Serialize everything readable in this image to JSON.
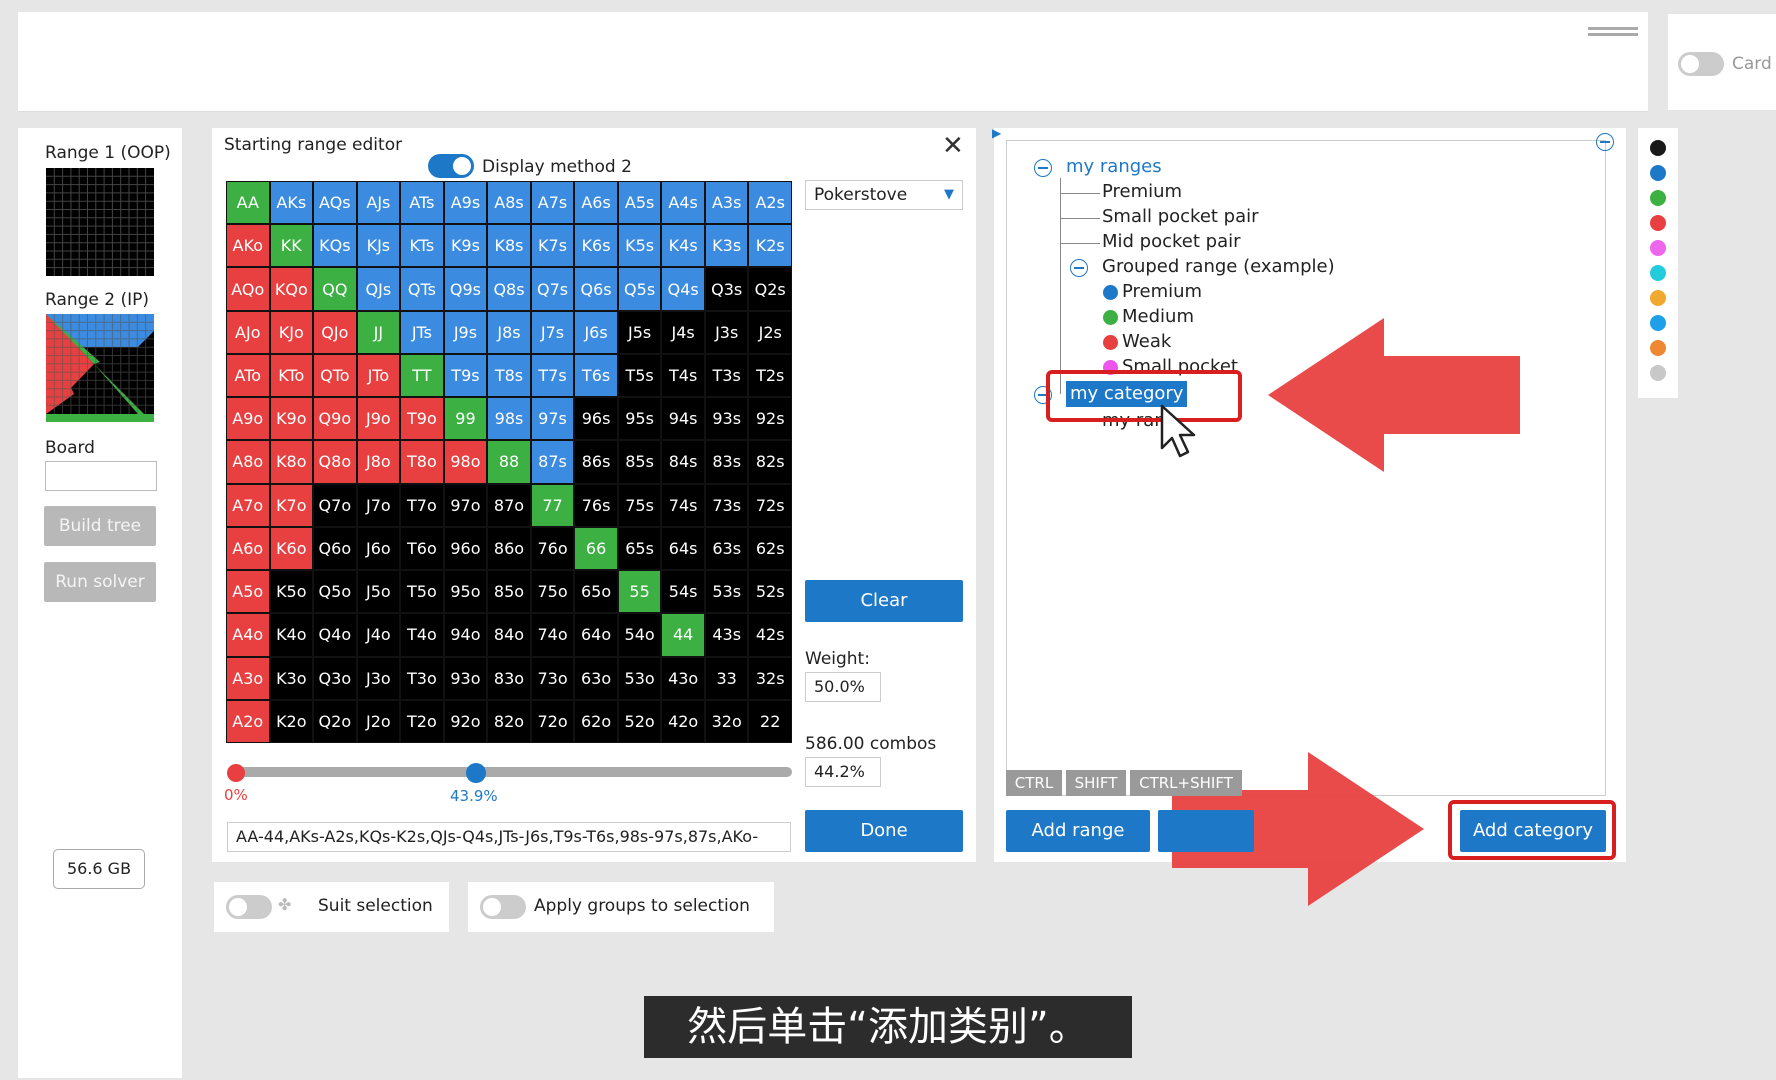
{
  "top": {
    "card_label": "Card"
  },
  "left_panel": {
    "range1_label": "Range 1 (OOP)",
    "range2_label": "Range 2 (IP)",
    "board_label": "Board",
    "build_tree": "Build tree",
    "run_solver": "Run solver",
    "memory": "56.6 GB"
  },
  "editor": {
    "title": "Starting range editor",
    "display_method": "Display method 2",
    "display_method_on": true,
    "preset": "Pokerstove",
    "clear": "Clear",
    "weight_label": "Weight:",
    "weight_value": "50.0%",
    "combos_label": "586.00 combos",
    "combos_pct": "44.2%",
    "slider_min": "0%",
    "slider_value": "43.9%",
    "range_text": "AA-44,AKs-A2s,KQs-K2s,QJs-Q4s,JTs-J6s,T9s-T6s,98s-97s,87s,AKo-",
    "done": "Done",
    "grid": [
      [
        "AA",
        "AKs",
        "AQs",
        "AJs",
        "ATs",
        "A9s",
        "A8s",
        "A7s",
        "A6s",
        "A5s",
        "A4s",
        "A3s",
        "A2s"
      ],
      [
        "AKo",
        "KK",
        "KQs",
        "KJs",
        "KTs",
        "K9s",
        "K8s",
        "K7s",
        "K6s",
        "K5s",
        "K4s",
        "K3s",
        "K2s"
      ],
      [
        "AQo",
        "KQo",
        "QQ",
        "QJs",
        "QTs",
        "Q9s",
        "Q8s",
        "Q7s",
        "Q6s",
        "Q5s",
        "Q4s",
        "Q3s",
        "Q2s"
      ],
      [
        "AJo",
        "KJo",
        "QJo",
        "JJ",
        "JTs",
        "J9s",
        "J8s",
        "J7s",
        "J6s",
        "J5s",
        "J4s",
        "J3s",
        "J2s"
      ],
      [
        "ATo",
        "KTo",
        "QTo",
        "JTo",
        "TT",
        "T9s",
        "T8s",
        "T7s",
        "T6s",
        "T5s",
        "T4s",
        "T3s",
        "T2s"
      ],
      [
        "A9o",
        "K9o",
        "Q9o",
        "J9o",
        "T9o",
        "99",
        "98s",
        "97s",
        "96s",
        "95s",
        "94s",
        "93s",
        "92s"
      ],
      [
        "A8o",
        "K8o",
        "Q8o",
        "J8o",
        "T8o",
        "98o",
        "88",
        "87s",
        "86s",
        "85s",
        "84s",
        "83s",
        "82s"
      ],
      [
        "A7o",
        "K7o",
        "Q7o",
        "J7o",
        "T7o",
        "97o",
        "87o",
        "77",
        "76s",
        "75s",
        "74s",
        "73s",
        "72s"
      ],
      [
        "A6o",
        "K6o",
        "Q6o",
        "J6o",
        "T6o",
        "96o",
        "86o",
        "76o",
        "66",
        "65s",
        "64s",
        "63s",
        "62s"
      ],
      [
        "A5o",
        "K5o",
        "Q5o",
        "J5o",
        "T5o",
        "95o",
        "85o",
        "75o",
        "65o",
        "55",
        "54s",
        "53s",
        "52s"
      ],
      [
        "A4o",
        "K4o",
        "Q4o",
        "J4o",
        "T4o",
        "94o",
        "84o",
        "74o",
        "64o",
        "54o",
        "44",
        "43s",
        "42s"
      ],
      [
        "A3o",
        "K3o",
        "Q3o",
        "J3o",
        "T3o",
        "93o",
        "83o",
        "73o",
        "63o",
        "53o",
        "43o",
        "33",
        "32s"
      ],
      [
        "A2o",
        "K2o",
        "Q2o",
        "J2o",
        "T2o",
        "92o",
        "82o",
        "72o",
        "62o",
        "52o",
        "42o",
        "32o",
        "22"
      ]
    ],
    "grid_colors": [
      "gbbbbbbbbbbbb",
      "rgbbbbbbbbbbb",
      "rrgbbbbbbbbkk",
      "rrrgbbbbbkkkk",
      "rrrrgbbbbkkkk",
      "rrrrrgbbkkkkk",
      "rrrrrrgbkkkkk",
      "rrkkkkkgkkkkk",
      "rrkkkkkkgkkkk",
      "rkkkkkkkkgkkk",
      "rkkkkkkkkkgkk",
      "rkkkkkkkkkkkk",
      "rkkkkkkkkkkkk"
    ],
    "colors": {
      "g": "#3cb043",
      "b": "#3b8be0",
      "r": "#e84040",
      "k": "#000000"
    }
  },
  "bottom": {
    "suit_selection": "Suit selection",
    "apply_groups": "Apply groups to selection"
  },
  "tree": {
    "root": "my ranges",
    "items": [
      "Premium",
      "Small pocket pair",
      "Mid pocket pair",
      "Grouped range (example)"
    ],
    "group_items": [
      {
        "label": "Premium",
        "color": "#1e78c8"
      },
      {
        "label": "Medium",
        "color": "#3cb043"
      },
      {
        "label": "Weak",
        "color": "#e84040"
      },
      {
        "label": "Small pocket",
        "color": "#ee55ee"
      }
    ],
    "selected": "my category",
    "below_selected": "my ran",
    "key_tabs": [
      "CTRL",
      "SHIFT",
      "CTRL+SHIFT"
    ],
    "add_range": "Add range",
    "add_category": "Add category"
  },
  "palette": [
    "#1a1a1a",
    "#1e78c8",
    "#3cb043",
    "#e84040",
    "#ee66ee",
    "#22ccdd",
    "#f0a830",
    "#1ea0e8",
    "#ee8833",
    "#c8c8c8"
  ],
  "subtitle": "然后单击“添加类别”。"
}
